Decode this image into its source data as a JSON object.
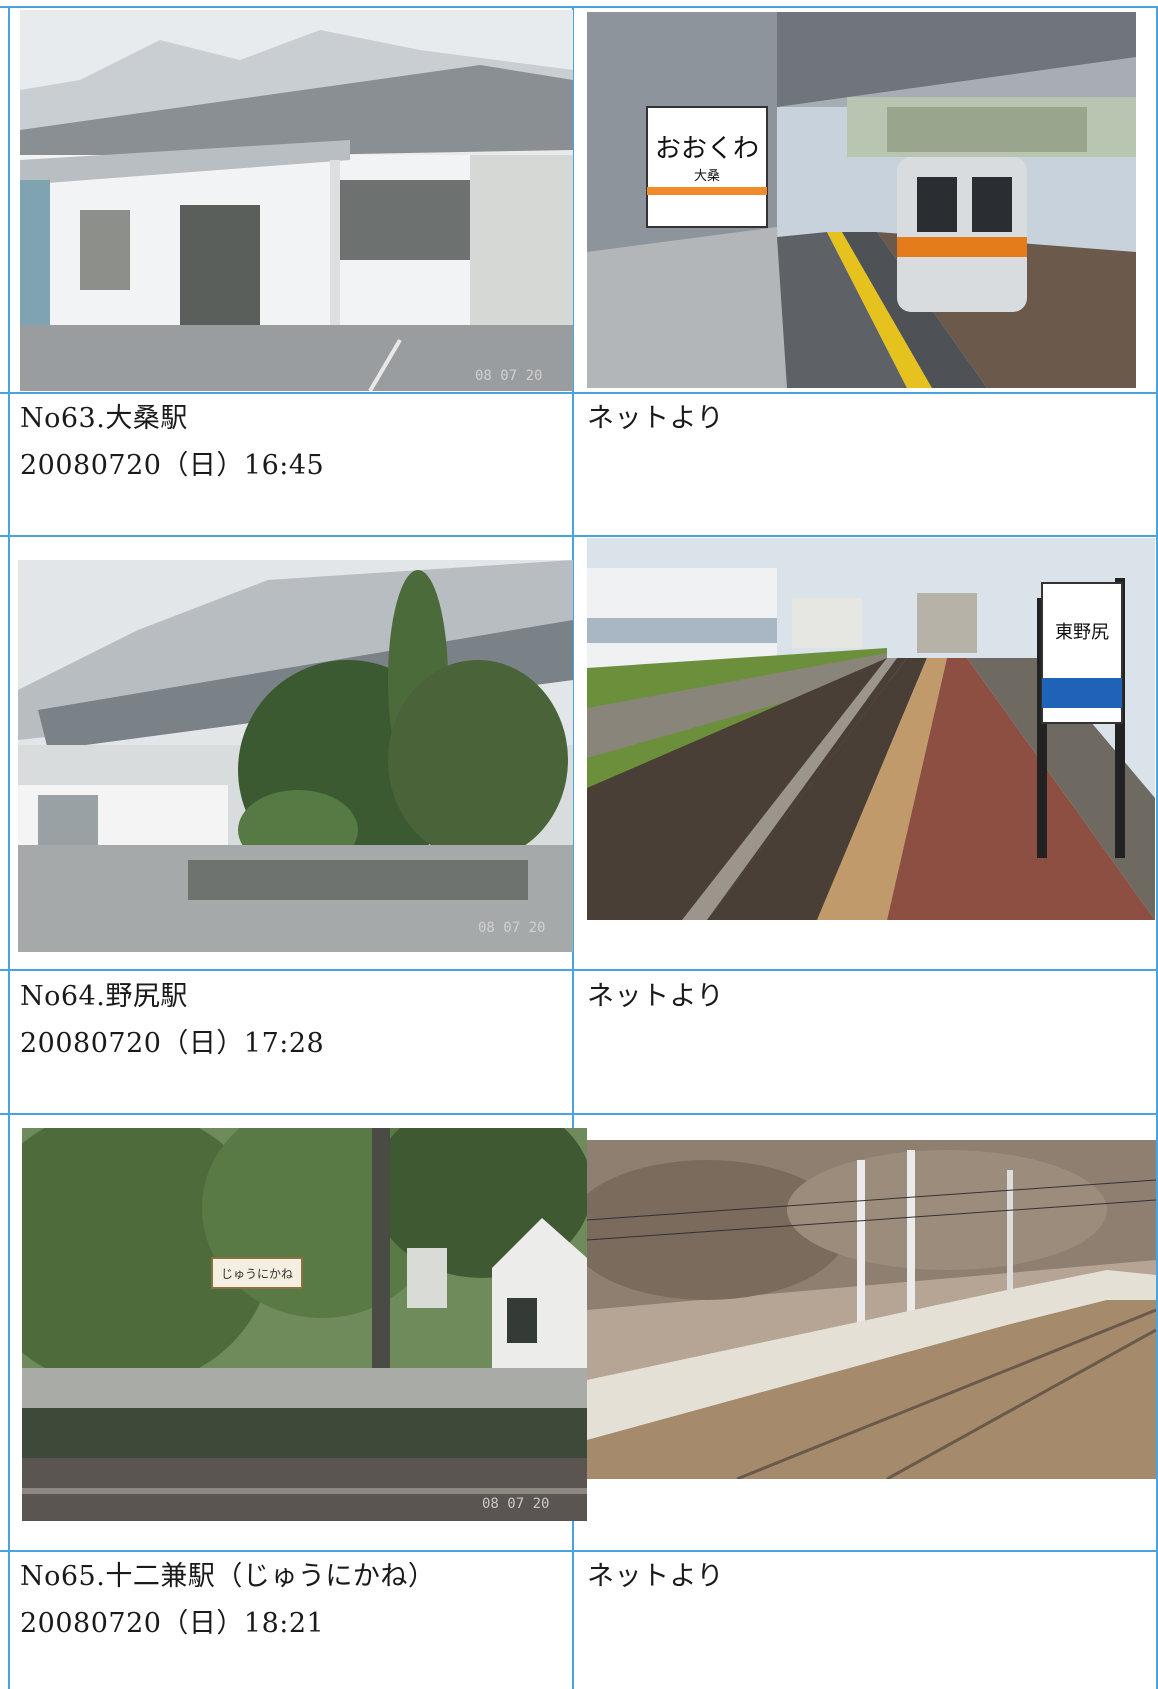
{
  "entries": [
    {
      "title": "No63.大桑駅",
      "datetime": "20080720（日）16:45",
      "note": "ネットより",
      "photo_stamp": "08 07 20",
      "station_sign": "おおくわ",
      "station_sign_sub": "大桑"
    },
    {
      "title": "No64.野尻駅",
      "datetime": "20080720（日）17:28",
      "note": "ネットより",
      "photo_stamp": "08 07 20",
      "station_sign": "東野尻"
    },
    {
      "title": "No65.十二兼駅（じゅうにかね）",
      "datetime": "20080720（日）18:21",
      "note": "ネットより",
      "photo_stamp": "08 07 20",
      "station_sign": "じゅうにかね"
    }
  ]
}
